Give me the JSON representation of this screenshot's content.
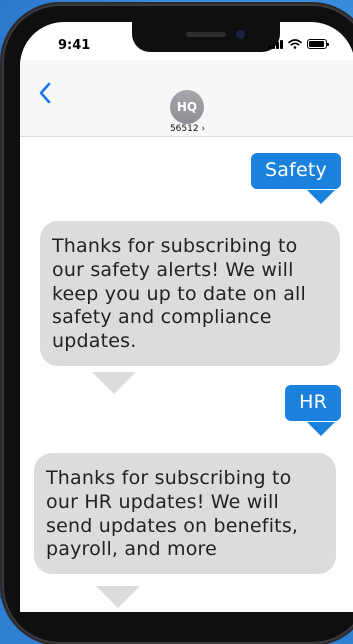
{
  "status_bar": {
    "time": "9:41"
  },
  "header": {
    "avatar_initials": "HQ",
    "contact_number": "56512 ›"
  },
  "messages": [
    {
      "direction": "outgoing",
      "text": "Safety"
    },
    {
      "direction": "incoming",
      "text": "Thanks for subscribing to our safety alerts! We will keep you up to date on all safety and compliance updates."
    },
    {
      "direction": "outgoing",
      "text": "HR"
    },
    {
      "direction": "incoming",
      "text": "Thanks for subscribing to our HR updates! We will send updates on benefits, payroll, and more"
    }
  ],
  "colors": {
    "outgoing_bubble": "#1a82dd",
    "incoming_bubble": "#dcdcdc",
    "accent": "#1a78e8",
    "background": "#2f7fd3"
  },
  "icons": [
    "back-chevron-icon",
    "signal-icon",
    "wifi-icon",
    "battery-icon"
  ]
}
